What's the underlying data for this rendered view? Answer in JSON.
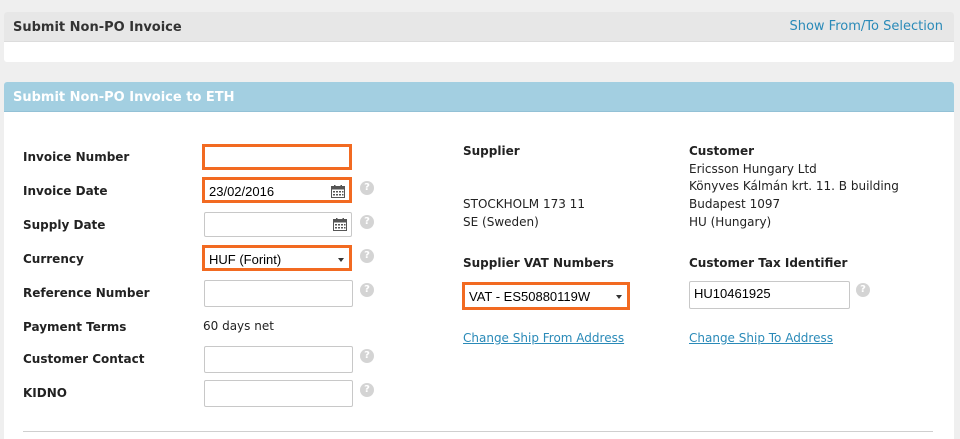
{
  "top": {
    "title": "Submit Non-PO Invoice",
    "show_link": "Show From/To Selection"
  },
  "main": {
    "title": "Submit Non-PO Invoice to ETH"
  },
  "form": {
    "invoice_number_label": "Invoice Number",
    "invoice_number_value": "",
    "invoice_date_label": "Invoice Date",
    "invoice_date_value": "23/02/2016",
    "supply_date_label": "Supply Date",
    "supply_date_value": "",
    "currency_label": "Currency",
    "currency_value": "HUF (Forint)",
    "reference_label": "Reference Number",
    "reference_value": "",
    "payment_terms_label": "Payment Terms",
    "payment_terms_value": "60 days net",
    "contact_label": "Customer Contact",
    "contact_value": "",
    "kidno_label": "KIDNO",
    "kidno_value": ""
  },
  "supplier": {
    "heading": "Supplier",
    "city_line": "STOCKHOLM 173 11",
    "country_line": "SE (Sweden)",
    "vat_heading": "Supplier VAT Numbers",
    "vat_value": "VAT - ES50880119W",
    "change_link": "Change Ship From Address"
  },
  "customer": {
    "heading": "Customer",
    "name": "Ericsson Hungary Ltd",
    "address1": "Könyves Kálmán krt. 11. B building",
    "address2": "Budapest 1097",
    "country": "HU (Hungary)",
    "tax_heading": "Customer Tax Identifier",
    "tax_value": "HU10461925",
    "change_link": "Change Ship To Address"
  },
  "help_glyph": "?",
  "accent_color": "#f26a21",
  "link_color": "#2a8ab8",
  "header_color": "#a3cfe1"
}
